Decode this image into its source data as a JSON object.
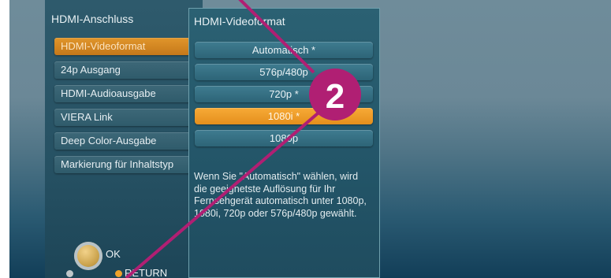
{
  "left_menu": {
    "title": "HDMI-Anschluss",
    "items": [
      {
        "label": "HDMI-Videoformat",
        "active": true
      },
      {
        "label": "24p Ausgang",
        "active": false
      },
      {
        "label": "HDMI-Audioausgabe",
        "active": false
      },
      {
        "label": "VIERA Link",
        "active": false
      },
      {
        "label": "Deep Color-Ausgabe",
        "active": false
      },
      {
        "label": "Markierung für Inhaltstyp",
        "active": false
      }
    ]
  },
  "bottom_nav": {
    "ok_label": "OK",
    "return_label": "RETURN"
  },
  "submenu": {
    "title": "HDMI-Videoformat",
    "options": [
      {
        "label": "Automatisch *",
        "selected": false
      },
      {
        "label": "576p/480p",
        "selected": false
      },
      {
        "label": "720p *",
        "selected": false
      },
      {
        "label": "1080i *",
        "selected": true
      },
      {
        "label": "1080p",
        "selected": false
      }
    ],
    "description": "Wenn Sie \"Automatisch\" wählen, wird die geeignetste Auflösung für Ihr Fernsehgerät automatisch unter 1080p, 1080i, 720p oder 576p/480p gewählt."
  },
  "annotation": {
    "step_number": "2",
    "color": "#b01f73"
  },
  "colors": {
    "accent_orange": "#e48f1c",
    "annotation_magenta": "#b01f73"
  }
}
